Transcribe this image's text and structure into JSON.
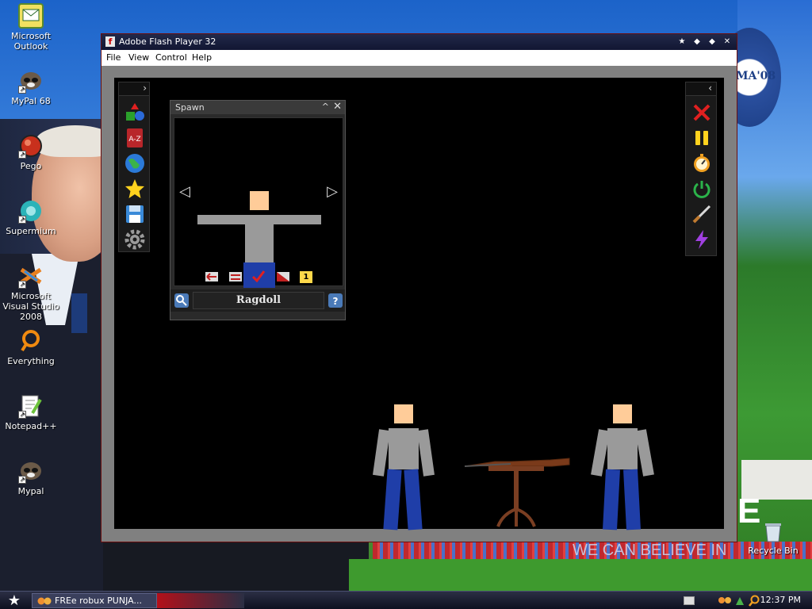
{
  "desktop": {
    "icons": [
      {
        "label": "Microsoft Outlook",
        "icon": "outlook-icon"
      },
      {
        "label": "MyPal 68",
        "icon": "mypal-icon"
      },
      {
        "label": "Pego",
        "icon": "pego-icon"
      },
      {
        "label": "Supermium",
        "icon": "supermium-icon"
      },
      {
        "label": "Microsoft Visual Studio 2008",
        "icon": "visual-studio-icon"
      },
      {
        "label": "Everything",
        "icon": "everything-icon"
      },
      {
        "label": "Notepad++",
        "icon": "notepadpp-icon"
      },
      {
        "label": "Mypal",
        "icon": "mypal-icon"
      },
      {
        "label": "Recycle Bin",
        "icon": "recycle-bin-icon"
      }
    ],
    "wallpaper": {
      "slogan": "WE CAN BELIEVE IN",
      "slogan_letter": "E",
      "logo_text": "MA'08"
    }
  },
  "window": {
    "title": "Adobe Flash Player 32",
    "menu": [
      "File",
      "View",
      "Control",
      "Help"
    ]
  },
  "spawn_panel": {
    "title": "Spawn",
    "item_name": "Ragdoll",
    "count_badge": "1"
  },
  "left_tools": [
    "shapes-icon",
    "a-z-icon",
    "globe-icon",
    "star-icon",
    "save-icon",
    "settings-gear-icon"
  ],
  "right_tools": [
    "delete-x-icon",
    "pause-icon",
    "stopwatch-icon",
    "power-icon",
    "knife-icon",
    "lightning-icon"
  ],
  "taskbar": {
    "task_label": "FREe robux PUNJA...",
    "clock": "12:37 PM"
  },
  "colors": {
    "accent_red": "#d92b2b",
    "ragdoll_skin": "#ffcc99",
    "ragdoll_body": "#9a9a9a",
    "ragdoll_legs": "#1f3ea8"
  }
}
